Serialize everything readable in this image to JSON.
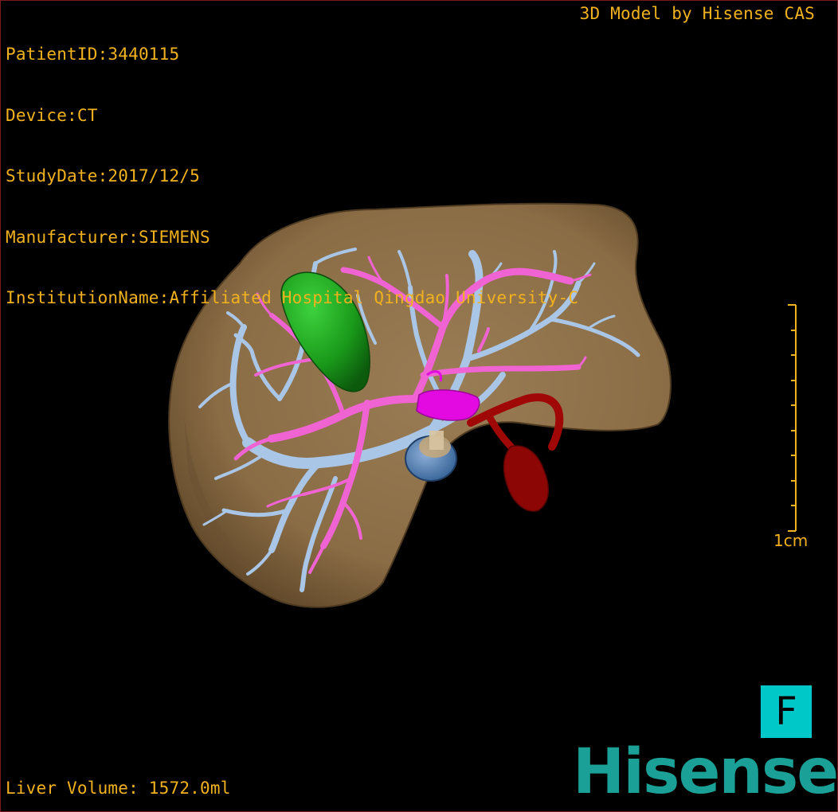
{
  "patient_info": {
    "patient_id": "PatientID:3440115",
    "device": "Device:CT",
    "study_date": "StudyDate:2017/12/5",
    "manufacturer": "Manufacturer:SIEMENS",
    "institution": "InstitutionName:Affiliated Hospital Qingdao University-C"
  },
  "model_credit": "3D Model by Hisense CAS",
  "liver_volume": "Liver Volume: 1572.0ml",
  "scale_bar": {
    "label": "1cm"
  },
  "orientation_marker": "F",
  "brand_logo": "Hisense",
  "icons": {
    "liver_model": "liver-3d-model",
    "orientation": "orientation-cube"
  },
  "colors": {
    "overlay_text": "#f2b21e",
    "liver": "#8a6c45",
    "portal_vein": "#aac6e6",
    "hepatic_vessel": "#f063d2",
    "gallbladder": "#1a9a1a",
    "artery": "#a00808",
    "orientation_box": "#00c8c8",
    "brand": "#1aa096"
  }
}
